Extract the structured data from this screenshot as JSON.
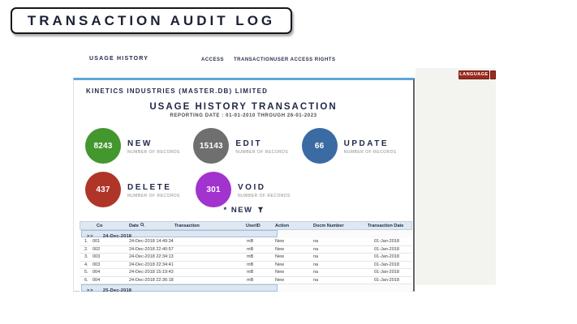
{
  "page": {
    "title": "TRANSACTION AUDIT LOG"
  },
  "nav": {
    "brand": "USAGE HISTORY",
    "tabs": [
      {
        "label": "ACCESS"
      },
      {
        "label": "TRANSACTION"
      },
      {
        "label": "USER ACCESS RIGHTS"
      }
    ],
    "language_button": "LANGUAGE"
  },
  "report": {
    "company": "KINETICS INDUSTRIES (MASTER.DB) LIMITED",
    "title": "USAGE HISTORY TRANSACTION",
    "subtitle": "REPORTING DATE :  01-01-2010 THROUGH  26-01-2023",
    "stats": [
      {
        "value": "8243",
        "label": "NEW",
        "sublabel": "NUMBER OF RECORDS",
        "color": "#44962f"
      },
      {
        "value": "15143",
        "label": "EDIT",
        "sublabel": "NUMBER OF RECORDS",
        "color": "#6f6f6f"
      },
      {
        "value": "66",
        "label": "UPDATE",
        "sublabel": "NUMBER OF RECORDS",
        "color": "#3a6ba3"
      },
      {
        "value": "437",
        "label": "DELETE",
        "sublabel": "NUMBER OF RECORDS",
        "color": "#b03529"
      },
      {
        "value": "301",
        "label": "VOID",
        "sublabel": "NUMBER OF RECORDS",
        "color": "#a233cf"
      }
    ],
    "filter": {
      "label": "* NEW",
      "icon": "filter-funnel"
    }
  },
  "table": {
    "columns": [
      "Co",
      "Date",
      "Transaction",
      "UserID",
      "Action",
      "Docm Number",
      "Transaction Date"
    ],
    "group_expand_glyph": ">>",
    "groups": [
      {
        "label": "24-Dec-2018",
        "rows": [
          {
            "idx": "1.",
            "co": "001",
            "date": "24-Dec-2018  14:49:34",
            "transaction": "",
            "userid": "mB",
            "action": "New",
            "docm": "na",
            "txdate": "01-Jan-2018"
          },
          {
            "idx": "2.",
            "co": "002",
            "date": "24-Dec-2018  22:40:57",
            "transaction": "",
            "userid": "mB",
            "action": "New",
            "docm": "na",
            "txdate": "01-Jan-2018"
          },
          {
            "idx": "3.",
            "co": "003",
            "date": "24-Dec-2018  22:34:13",
            "transaction": "",
            "userid": "mB",
            "action": "New",
            "docm": "na",
            "txdate": "01-Jan-2018"
          },
          {
            "idx": "4.",
            "co": "003",
            "date": "24-Dec-2018  22:34:41",
            "transaction": "",
            "userid": "mB",
            "action": "New",
            "docm": "na",
            "txdate": "01-Jan-2018"
          },
          {
            "idx": "5.",
            "co": "004",
            "date": "24-Dec-2018  15:19:43",
            "transaction": "",
            "userid": "mB",
            "action": "New",
            "docm": "na",
            "txdate": "01-Jan-2018"
          },
          {
            "idx": "6.",
            "co": "004",
            "date": "24-Dec-2018  22:36:18",
            "transaction": "",
            "userid": "mB",
            "action": "New",
            "docm": "na",
            "txdate": "01-Jan-2018"
          }
        ]
      },
      {
        "label": "25-Dec-2018",
        "rows": []
      }
    ]
  }
}
